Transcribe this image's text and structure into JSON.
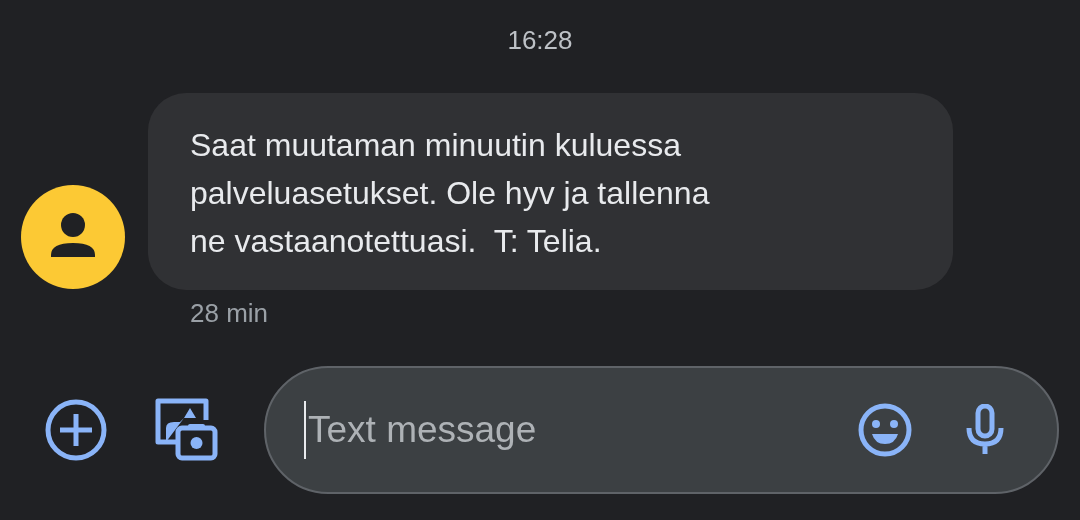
{
  "timestamp": "16:28",
  "messages": [
    {
      "text": "Saat muutaman minuutin kuluessa\npalveluasetukset. Ole hyv ja tallenna\nne vastaanotettuasi.  T: Telia.",
      "time": "28 min",
      "color": "#fcc934"
    }
  ],
  "composer": {
    "placeholder": "Text message"
  }
}
